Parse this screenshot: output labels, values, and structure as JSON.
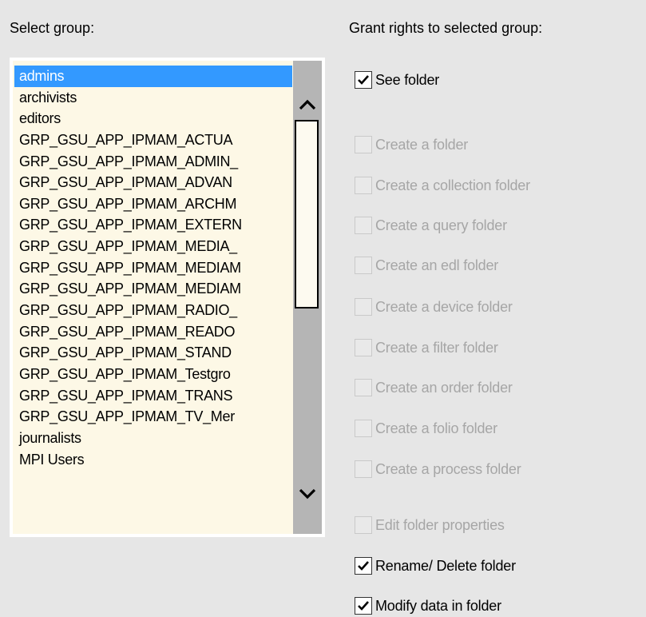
{
  "headings": {
    "select_group": "Select group:",
    "grant_rights": "Grant rights to selected group:"
  },
  "groups": {
    "selected_index": 0,
    "items": [
      "admins",
      "archivists",
      "editors",
      "GRP_GSU_APP_IPMAM_ACTUA",
      "GRP_GSU_APP_IPMAM_ADMIN_",
      "GRP_GSU_APP_IPMAM_ADVAN",
      "GRP_GSU_APP_IPMAM_ARCHM",
      "GRP_GSU_APP_IPMAM_EXTERN",
      "GRP_GSU_APP_IPMAM_MEDIA_",
      "GRP_GSU_APP_IPMAM_MEDIAM",
      "GRP_GSU_APP_IPMAM_MEDIAM",
      "GRP_GSU_APP_IPMAM_RADIO_",
      "GRP_GSU_APP_IPMAM_READO",
      "GRP_GSU_APP_IPMAM_STAND",
      "GRP_GSU_APP_IPMAM_Testgro",
      "GRP_GSU_APP_IPMAM_TRANS",
      "GRP_GSU_APP_IPMAM_TV_Mer",
      "journalists",
      "MPI Users"
    ]
  },
  "permissions": [
    {
      "label": "See folder",
      "checked": true,
      "enabled": true
    },
    {
      "label": "Create a folder",
      "checked": false,
      "enabled": false
    },
    {
      "label": "Create a collection folder",
      "checked": false,
      "enabled": false
    },
    {
      "label": "Create a query folder",
      "checked": false,
      "enabled": false
    },
    {
      "label": "Create an edl folder",
      "checked": false,
      "enabled": false
    },
    {
      "label": "Create a device folder",
      "checked": false,
      "enabled": false
    },
    {
      "label": "Create a filter folder",
      "checked": false,
      "enabled": false
    },
    {
      "label": "Create an order folder",
      "checked": false,
      "enabled": false
    },
    {
      "label": "Create a folio folder",
      "checked": false,
      "enabled": false
    },
    {
      "label": "Create a process folder",
      "checked": false,
      "enabled": false
    },
    {
      "label": "Edit folder properties",
      "checked": false,
      "enabled": false
    },
    {
      "label": "Rename/ Delete folder",
      "checked": true,
      "enabled": true
    },
    {
      "label": "Modify  data in folder",
      "checked": true,
      "enabled": true
    }
  ],
  "icons": {
    "scroll_up": "chevron-up-icon",
    "scroll_down": "chevron-down-icon",
    "check": "checkmark-icon"
  },
  "colors": {
    "selection": "#3399ff",
    "list_background": "#fdf8e6",
    "dialog_background": "#e6e6e6",
    "disabled_text": "#a6a6a6"
  }
}
